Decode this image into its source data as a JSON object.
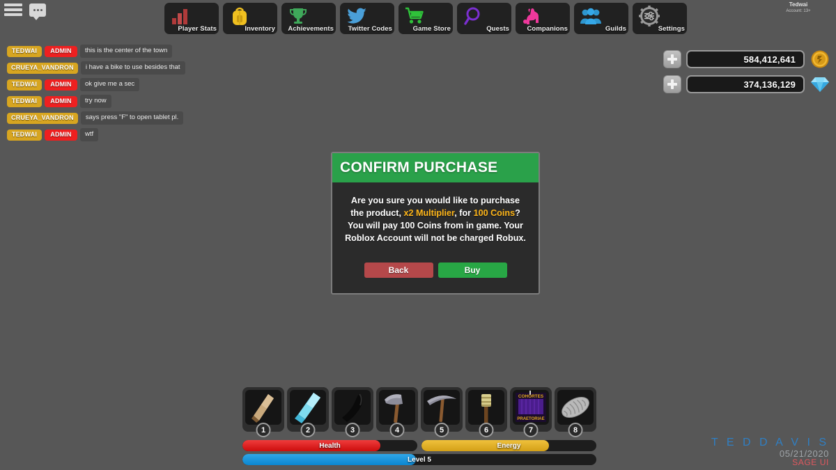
{
  "topbar": {
    "menu_icon": "hamburger-menu-icon",
    "chat_icon": "chat-bubble-icon"
  },
  "account": {
    "username": "Tedwai",
    "rating": "Account: 13+"
  },
  "nav": {
    "items": [
      {
        "label": "Player Stats",
        "icon": "bar-chart-icon",
        "color": "#b03a3a"
      },
      {
        "label": "Inventory",
        "icon": "backpack-icon",
        "color": "#f0c020"
      },
      {
        "label": "Achievements",
        "icon": "trophy-icon",
        "color": "#3fa85a"
      },
      {
        "label": "Twitter Codes",
        "icon": "twitter-bird-icon",
        "color": "#4a9fd8"
      },
      {
        "label": "Game Store",
        "icon": "shopping-cart-icon",
        "color": "#2fc23a"
      },
      {
        "label": "Quests",
        "icon": "magnifier-icon",
        "color": "#7b2fd0"
      },
      {
        "label": "Companions",
        "icon": "dog-icon",
        "color": "#f0389c"
      },
      {
        "label": "Guilds",
        "icon": "people-group-icon",
        "color": "#35a8e8"
      },
      {
        "label": "Settings",
        "icon": "gear-icon",
        "color": "#9a9a9a"
      }
    ]
  },
  "chat": {
    "messages": [
      {
        "name": "TEDWAI",
        "admin": "ADMIN",
        "text": "this is the center of the town"
      },
      {
        "name": "CRUEYA_VANDRON",
        "admin": "",
        "text": "i have a bike to use besides that"
      },
      {
        "name": "TEDWAI",
        "admin": "ADMIN",
        "text": "ok give me a sec"
      },
      {
        "name": "TEDWAI",
        "admin": "ADMIN",
        "text": "try now"
      },
      {
        "name": "CRUEYA_VANDRON",
        "admin": "",
        "text": "says press \"F\" to open tablet pl."
      },
      {
        "name": "TEDWAI",
        "admin": "ADMIN",
        "text": "wtf"
      }
    ]
  },
  "currency": {
    "coins": {
      "value": "584,412,641",
      "icon": "gold-coin-icon",
      "add_label": "+"
    },
    "gems": {
      "value": "374,136,129",
      "icon": "blue-diamond-icon",
      "add_label": "+"
    }
  },
  "dialog": {
    "title": "CONFIRM PURCHASE",
    "body_part1": "Are you sure you would like to purchase the product, ",
    "product": "x2 Multiplier",
    "body_part2": ", for ",
    "price": "100 Coins",
    "body_part3": "? You will pay 100 Coins from in game. Your Roblox Account will not be charged Robux.",
    "back_label": "Back",
    "buy_label": "Buy",
    "header_color": "#2aa14a",
    "back_color": "#b5484a",
    "buy_color": "#28a745"
  },
  "hotbar": {
    "slots": [
      {
        "number": "1",
        "item": "wooden-club-icon"
      },
      {
        "number": "2",
        "item": "ice-sword-icon"
      },
      {
        "number": "3",
        "item": "black-bat-icon"
      },
      {
        "number": "4",
        "item": "axe-icon"
      },
      {
        "number": "5",
        "item": "pickaxe-icon"
      },
      {
        "number": "6",
        "item": "torch-icon"
      },
      {
        "number": "7",
        "item": "cohortes-praetoriae-banner-icon"
      },
      {
        "number": "8",
        "item": "rope-coil-icon"
      }
    ],
    "banner_top": "COHORTES",
    "banner_bottom": "PRAETORIAE"
  },
  "status": {
    "health": {
      "label": "Health",
      "percent": 79,
      "color": "#cc0d0d"
    },
    "energy": {
      "label": "Energy",
      "percent": 73,
      "color": "#d3a017"
    },
    "level": {
      "label": "Level 5",
      "percent": 49,
      "color": "#0b86d0"
    }
  },
  "watermark": {
    "name": "T E D   D A V I S",
    "date": "05/21/2020",
    "tag": "SAGE UI"
  }
}
